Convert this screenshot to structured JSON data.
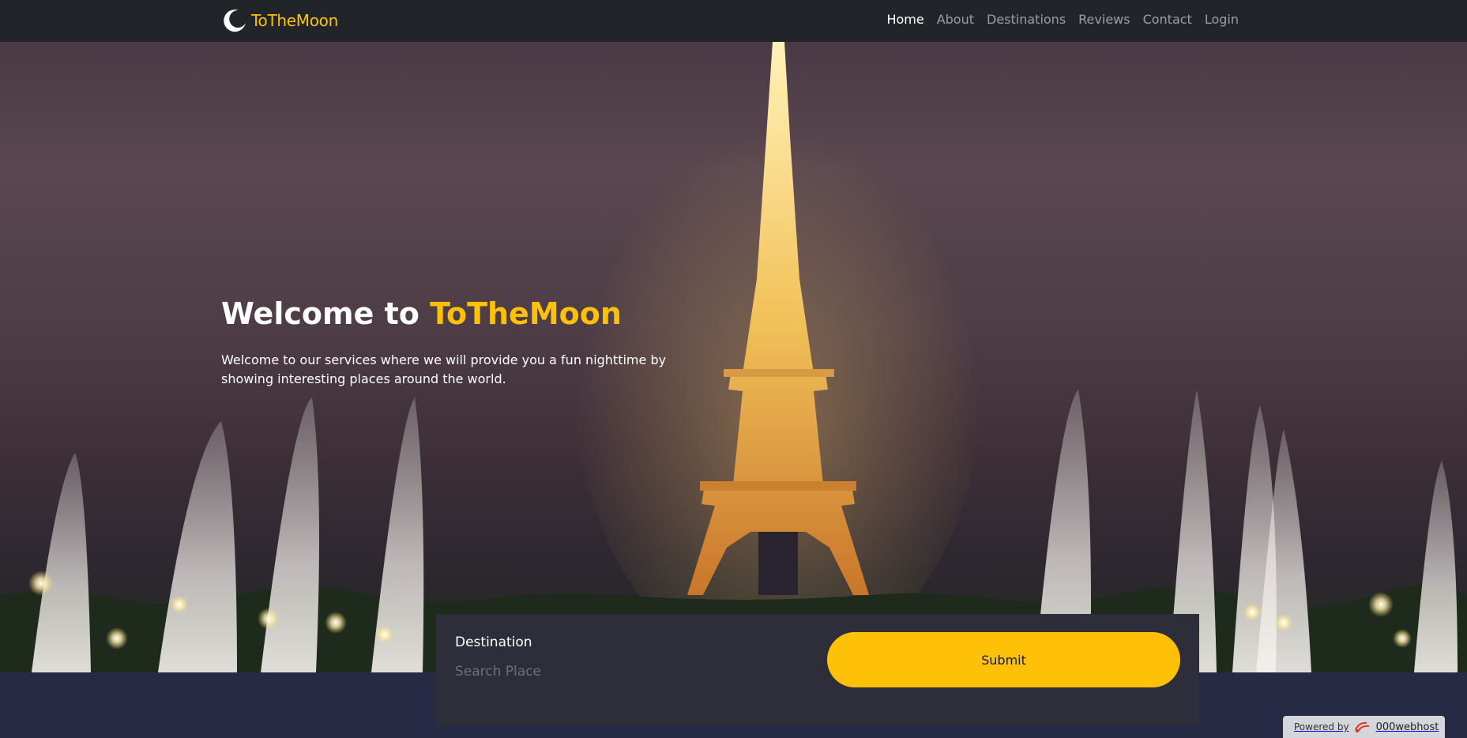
{
  "brand": {
    "name": "ToTheMoon",
    "accent_color": "#ffc107",
    "icon": "crescent-moon-icon"
  },
  "nav": {
    "items": [
      {
        "label": "Home",
        "active": true
      },
      {
        "label": "About",
        "active": false
      },
      {
        "label": "Destinations",
        "active": false
      },
      {
        "label": "Reviews",
        "active": false
      },
      {
        "label": "Contact",
        "active": false
      },
      {
        "label": "Login",
        "active": false
      }
    ]
  },
  "hero": {
    "title_prefix": "Welcome to ",
    "title_accent": "ToTheMoon",
    "subtitle": "Welcome to our services where we will provide you a fun nighttime by showing interesting places around the world."
  },
  "search": {
    "label": "Destination",
    "placeholder": "Search Place",
    "value": "",
    "submit_label": "Submit"
  },
  "footer_badge": {
    "prefix": "Powered by",
    "name": "000webhost",
    "icon": "webhost-logo-icon"
  },
  "colors": {
    "navbar": "#212529",
    "accent": "#ffc107",
    "panel": "#2d2e3a",
    "page_bg": "#262a45"
  }
}
